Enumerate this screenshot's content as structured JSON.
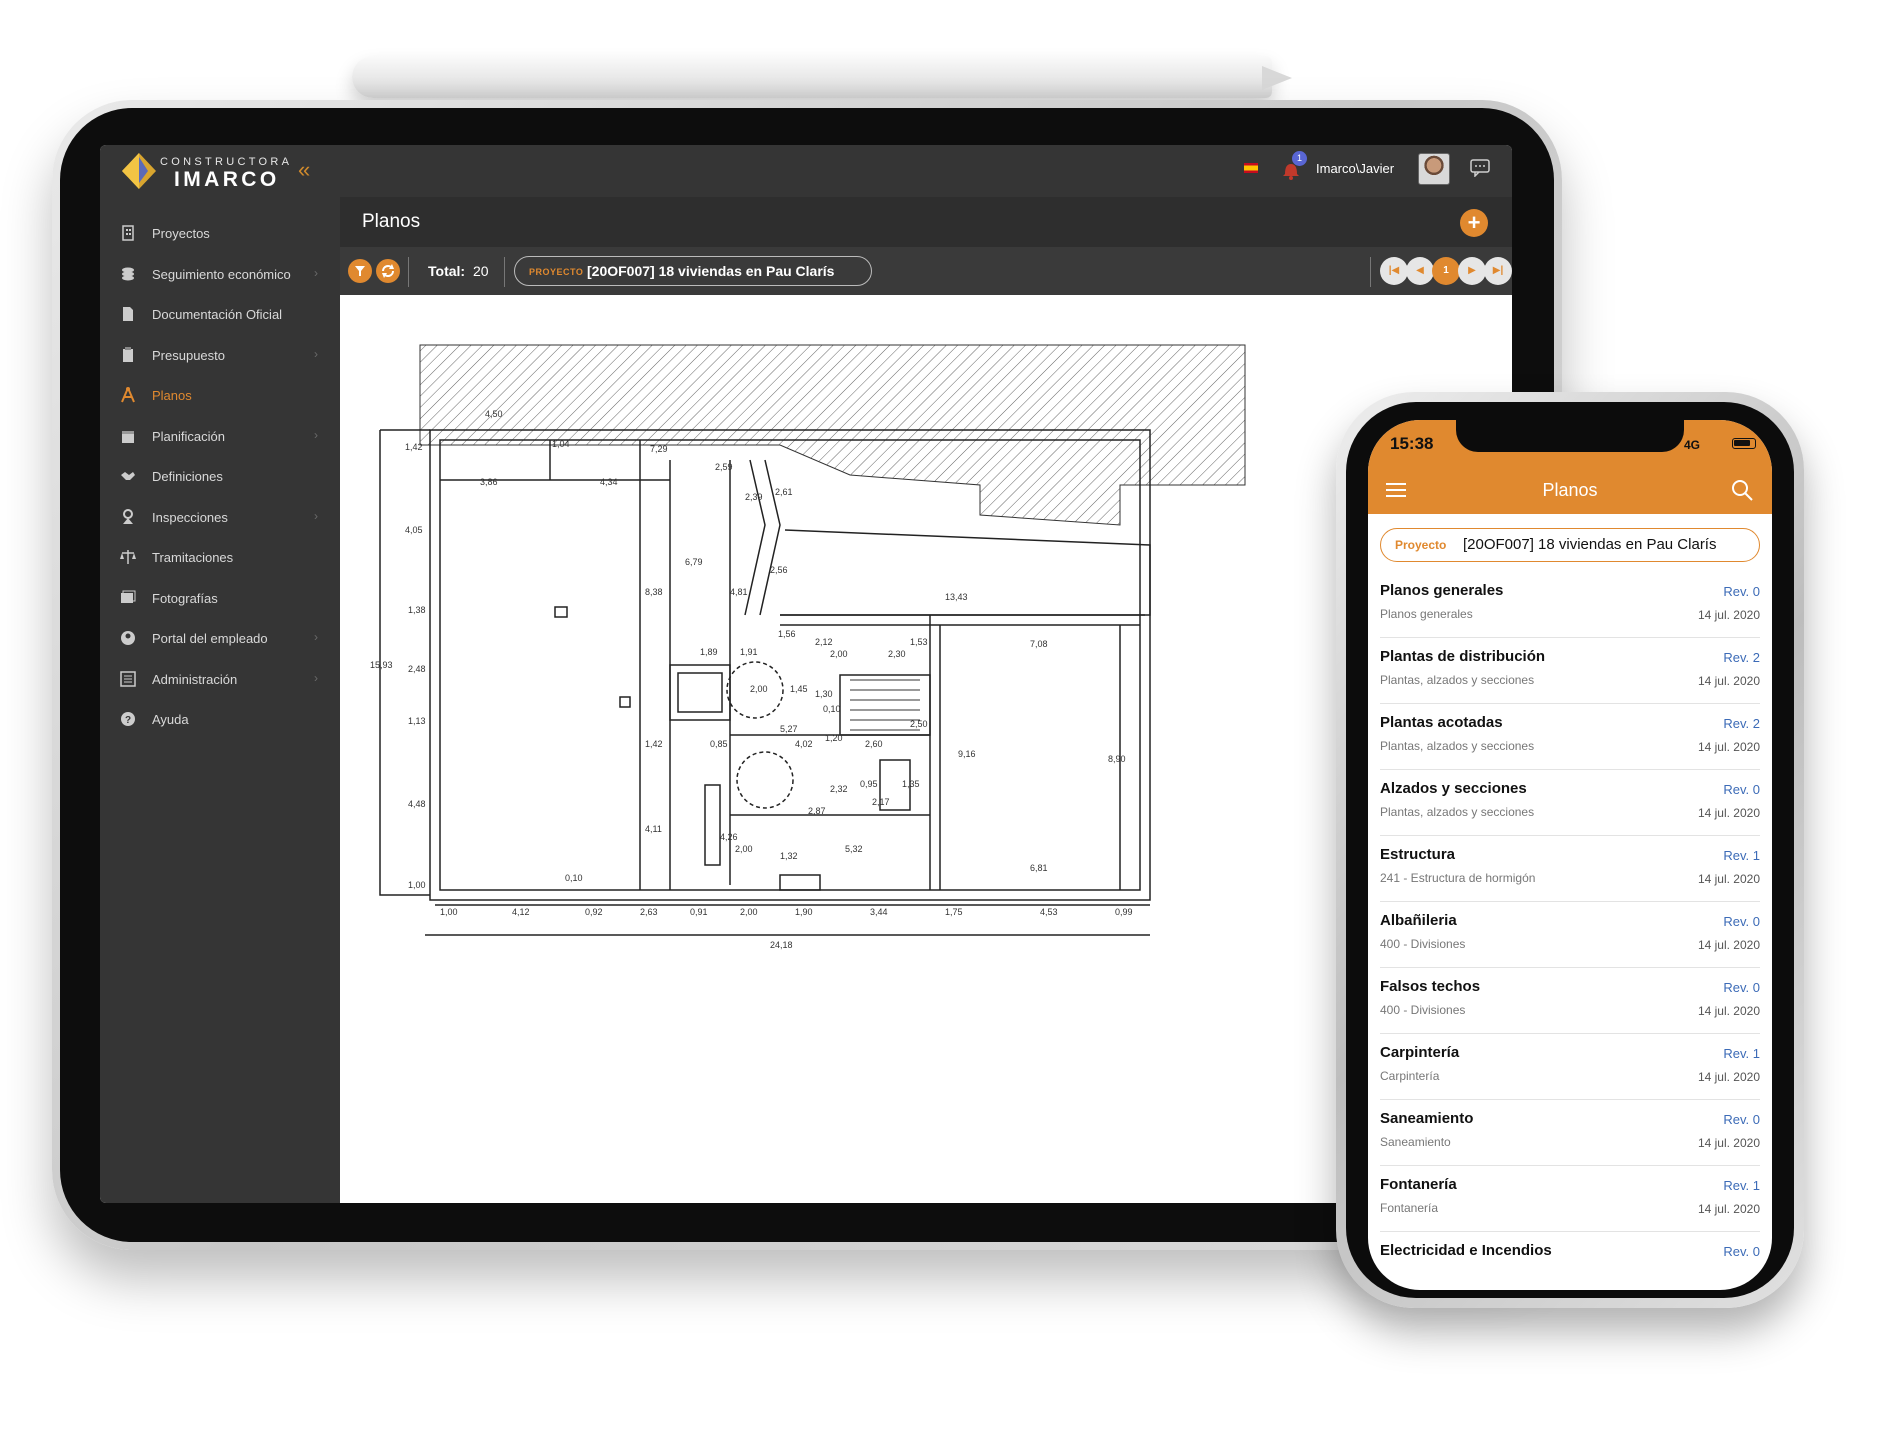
{
  "tablet": {
    "brand": {
      "small": "CONSTRUCTORA",
      "big": "IMARCO"
    },
    "collapse_icon": "double-chevron-left-icon",
    "notification_count": "1",
    "user": "Imarco\\Javier",
    "sidebar": {
      "items": [
        {
          "label": "Proyectos",
          "icon": "building-icon",
          "chevron": false
        },
        {
          "label": "Seguimiento económico",
          "icon": "coins-icon",
          "chevron": true
        },
        {
          "label": "Documentación Oficial",
          "icon": "document-icon",
          "chevron": false
        },
        {
          "label": "Presupuesto",
          "icon": "clipboard-icon",
          "chevron": true
        },
        {
          "label": "Planos",
          "icon": "compass-icon",
          "chevron": false,
          "active": true
        },
        {
          "label": "Planificación",
          "icon": "calendar-icon",
          "chevron": true
        },
        {
          "label": "Definiciones",
          "icon": "handshake-icon",
          "chevron": false
        },
        {
          "label": "Inspecciones",
          "icon": "inspector-icon",
          "chevron": true
        },
        {
          "label": "Tramitaciones",
          "icon": "scale-icon",
          "chevron": false
        },
        {
          "label": "Fotografías",
          "icon": "photos-icon",
          "chevron": false
        },
        {
          "label": "Portal del empleado",
          "icon": "user-circle-icon",
          "chevron": true
        },
        {
          "label": "Administración",
          "icon": "admin-icon",
          "chevron": true
        },
        {
          "label": "Ayuda",
          "icon": "help-icon",
          "chevron": false
        }
      ]
    },
    "header": {
      "title": "Planos",
      "add_label": "+"
    },
    "toolbar": {
      "total_label": "Total:",
      "total_value": "20",
      "project_tag": "PROYECTO",
      "project_name": "[20OF007] 18 viviendas en Pau Clarís",
      "current_page": "1"
    },
    "plan": {
      "dims": [
        "4,50",
        "1,04",
        "7,29",
        "3,86",
        "4,34",
        "2,59",
        "2,39",
        "2,61",
        "1,42",
        "4,05",
        "6,79",
        "2,56",
        "8,38",
        "4,81",
        "13,43",
        "1,38",
        "1,56",
        "2,12",
        "1,89",
        "1,91",
        "2,00",
        "2,30",
        "1,53",
        "15,93",
        "2,48",
        "2,00",
        "1,45",
        "1,30",
        "0,10",
        "7,08",
        "1,13",
        "5,27",
        "2,50",
        "1,42",
        "0,85",
        "4,02",
        "1,20",
        "2,60",
        "9,16",
        "8,90",
        "4,48",
        "2,32",
        "0,95",
        "1,35",
        "2,17",
        "2,87",
        "4,11",
        "4,26",
        "2,00",
        "1,32",
        "5,32",
        "6,81",
        "0,10",
        "1,00",
        "1,00",
        "4,12",
        "0,92",
        "2,63",
        "0,91",
        "2,00",
        "1,90",
        "3,44",
        "1,75",
        "4,53",
        "0,99",
        "24,18"
      ]
    }
  },
  "phone": {
    "time": "15:38",
    "network": "4G",
    "title": "Planos",
    "project_tag": "Proyecto",
    "project_name": "[20OF007] 18 viviendas en Pau Clarís",
    "items": [
      {
        "title": "Planos generales",
        "subtitle": "Planos generales",
        "rev": "Rev. 0",
        "date": "14 jul. 2020"
      },
      {
        "title": "Plantas de distribución",
        "subtitle": "Plantas, alzados y secciones",
        "rev": "Rev. 2",
        "date": "14 jul. 2020"
      },
      {
        "title": "Plantas acotadas",
        "subtitle": "Plantas, alzados y secciones",
        "rev": "Rev. 2",
        "date": "14 jul. 2020"
      },
      {
        "title": "Alzados y secciones",
        "subtitle": "Plantas, alzados y secciones",
        "rev": "Rev. 0",
        "date": "14 jul. 2020"
      },
      {
        "title": "Estructura",
        "subtitle": "241 - Estructura de hormigón",
        "rev": "Rev. 1",
        "date": "14 jul. 2020"
      },
      {
        "title": "Albañileria",
        "subtitle": "400 - Divisiones",
        "rev": "Rev. 0",
        "date": "14 jul. 2020"
      },
      {
        "title": "Falsos techos",
        "subtitle": "400 - Divisiones",
        "rev": "Rev. 0",
        "date": "14 jul. 2020"
      },
      {
        "title": "Carpintería",
        "subtitle": "Carpintería",
        "rev": "Rev. 1",
        "date": "14 jul. 2020"
      },
      {
        "title": "Saneamiento",
        "subtitle": "Saneamiento",
        "rev": "Rev. 0",
        "date": "14 jul. 2020"
      },
      {
        "title": "Fontanería",
        "subtitle": "Fontanería",
        "rev": "Rev. 1",
        "date": "14 jul. 2020"
      },
      {
        "title": "Electricidad e Incendios",
        "subtitle": "",
        "rev": "Rev. 0",
        "date": ""
      }
    ]
  },
  "colors": {
    "accent": "#e0892f",
    "dark": "#353535",
    "link": "#3c6bb7"
  }
}
